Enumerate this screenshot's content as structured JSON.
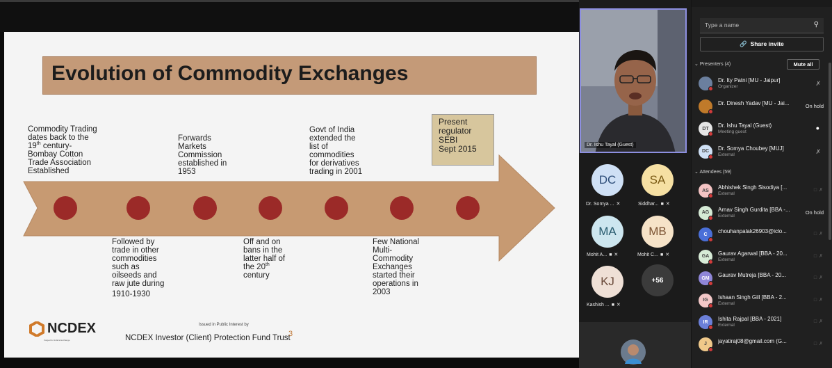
{
  "slide": {
    "title": "Evolution of Commodity Exchanges",
    "present_box": [
      "Present",
      "regulator",
      "SEBI",
      "Sept 2015"
    ],
    "top_texts": [
      [
        "Commodity Trading",
        "dates back to the",
        "19th century-",
        "Bombay Cotton",
        "Trade Association",
        "Established"
      ],
      [
        "Forwards",
        "Markets",
        "Commission",
        "established in",
        "1953"
      ],
      [
        "Govt of India",
        "extended the",
        "list of",
        "commodities",
        "for derivatives",
        "trading in 2001"
      ]
    ],
    "bottom_texts": [
      [
        "Followed by",
        "trade in other",
        "commodities",
        "such as",
        "oilseeds and",
        "raw jute during",
        "1910-1930"
      ],
      [
        "Off and on",
        "bans in the",
        "latter half of",
        "the 20th",
        "century"
      ],
      [
        "Few National",
        "Multi-",
        "Commodity",
        "Exchanges",
        "started their",
        "operations in",
        "2003"
      ]
    ],
    "logo_text": "NCDEX",
    "logo_sub": "Forged for India's Exchange",
    "issued": "Issued in Public Interest by",
    "trust": "NCDEX Investor (Client) Protection Fund Trust",
    "page_number": "3",
    "colors": {
      "title_bg": "#c49a78",
      "arrow": "#c79a72",
      "dot": "#9b2a28",
      "present_bg": "#d7c69d"
    }
  },
  "video": {
    "speaker_name": "Dr. Ishu Tayal (Guest)",
    "participants": [
      {
        "initials": "DC",
        "name": "Dr. Somya ...",
        "bg": "#cfe0f5",
        "fg": "#2f4f7a"
      },
      {
        "initials": "SA",
        "name": "Siddhar...",
        "bg": "#f6e0a3",
        "fg": "#7a5a14"
      },
      {
        "initials": "MA",
        "name": "Mohit A...",
        "bg": "#cde6ef",
        "fg": "#275a6e"
      },
      {
        "initials": "MB",
        "name": "Mohit C...",
        "bg": "#f6e3c8",
        "fg": "#7a5232"
      },
      {
        "initials": "KJ",
        "name": "Kashish ...",
        "bg": "#efe0d6",
        "fg": "#6a4a3a"
      }
    ],
    "more_count": "+56"
  },
  "panel": {
    "search_placeholder": "Type a name",
    "share_label": "Share invite",
    "presenters_header": "Presenters (4)",
    "mute_all": "Mute all",
    "attendees_header": "Attendees (59)",
    "presenters": [
      {
        "initials": "",
        "name": "Dr. Ity Patni [MU - Jaipur]",
        "sub": "Organizer",
        "right": "mic-off",
        "bg": "#6b7f9e"
      },
      {
        "initials": "",
        "name": "Dr. Dinesh Yadav [MU - Jai...",
        "sub": "",
        "right": "On hold",
        "bg": "#c07a2a"
      },
      {
        "initials": "DT",
        "name": "Dr. Ishu Tayal (Guest)",
        "sub": "Meeting guest",
        "right": "mic-on",
        "bg": "#e6e6e6"
      },
      {
        "initials": "DC",
        "name": "Dr. Somya Choubey [MUJ]",
        "sub": "External",
        "right": "mic-off",
        "bg": "#cfe0f5"
      }
    ],
    "attendees": [
      {
        "initials": "AS",
        "name": "Abhishek Singh Sisodiya [...",
        "sub": "External",
        "right": "icons",
        "bg": "#f4c3c3"
      },
      {
        "initials": "AG",
        "name": "Arnav Singh Gurdita [BBA -...",
        "sub": "External",
        "right": "On hold",
        "bg": "#d5ead5"
      },
      {
        "initials": "C",
        "name": "chouhanpalak26903@iclo...",
        "sub": "",
        "right": "icons",
        "bg": "#4a6fd8"
      },
      {
        "initials": "GA",
        "name": "Gaurav Agarwal [BBA - 20...",
        "sub": "External",
        "right": "icons",
        "bg": "#d7ecd7"
      },
      {
        "initials": "GM",
        "name": "Gaurav Mutreja [BBA - 20...",
        "sub": "",
        "right": "icons",
        "bg": "#8f86d8"
      },
      {
        "initials": "IG",
        "name": "Ishaan Singh Gill [BBA - 2...",
        "sub": "External",
        "right": "icons",
        "bg": "#f3c8c8"
      },
      {
        "initials": "IR",
        "name": "Ishita Rajpal [BBA - 2021]",
        "sub": "External",
        "right": "icons",
        "bg": "#6b7fd8"
      },
      {
        "initials": "J",
        "name": "jayatiraj08@gmail.com (G...",
        "sub": "",
        "right": "icons",
        "bg": "#f0c98a"
      }
    ]
  }
}
